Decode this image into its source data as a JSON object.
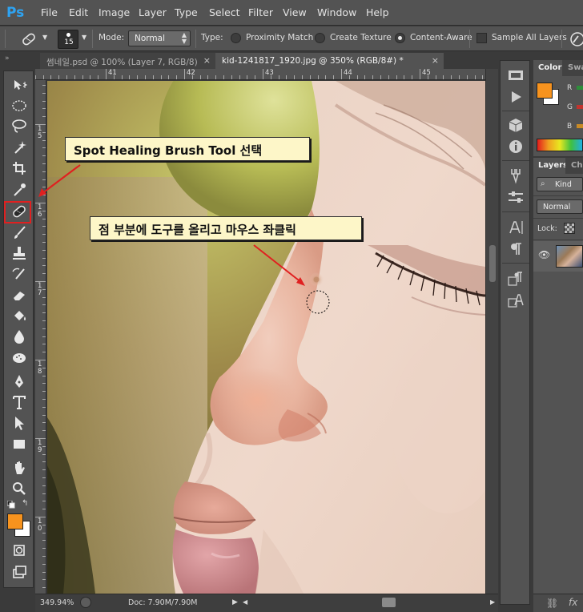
{
  "app": {
    "logo": "Ps"
  },
  "menu": [
    "File",
    "Edit",
    "Image",
    "Layer",
    "Type",
    "Select",
    "Filter",
    "View",
    "Window",
    "Help"
  ],
  "options_bar": {
    "brush_size": "15",
    "mode_label": "Mode:",
    "mode_value": "Normal",
    "type_label": "Type:",
    "types": [
      "Proximity Match",
      "Create Texture",
      "Content-Aware"
    ],
    "selected_type": "Content-Aware",
    "sample_all_layers_label": "Sample All Layers",
    "sample_all_layers_checked": false
  },
  "tabs": [
    {
      "label": "썸네일.psd @ 100% (Layer 7, RGB/8)",
      "active": false,
      "close": "×"
    },
    {
      "label": "kid-1241817_1920.jpg @ 350% (RGB/8#) *",
      "active": true,
      "close": "×"
    }
  ],
  "rulers": {
    "top": [
      "41",
      "42",
      "43",
      "44",
      "45"
    ],
    "left": [
      "5",
      "6",
      "7",
      "8",
      "9",
      "0"
    ]
  },
  "annotations": {
    "tool_callout": "Spot Healing Brush Tool 선택",
    "action_callout": "점 부분에 도구를 올리고 마우스 좌클릭",
    "highlight_color": "#e02020"
  },
  "status_bar": {
    "zoom": "349.94%",
    "doc": "Doc: 7.90M/7.90M"
  },
  "colors": {
    "foreground": "#f7931e",
    "background": "#ffffff"
  },
  "panels": {
    "color_tabs": [
      "Color",
      "Swa"
    ],
    "rgb_labels": [
      "R",
      "G",
      "B"
    ],
    "layers_tabs": [
      "Layers",
      "Cha"
    ],
    "kind_placeholder": "Kind",
    "blend_mode": "Normal",
    "lock_label": "Lock:"
  }
}
